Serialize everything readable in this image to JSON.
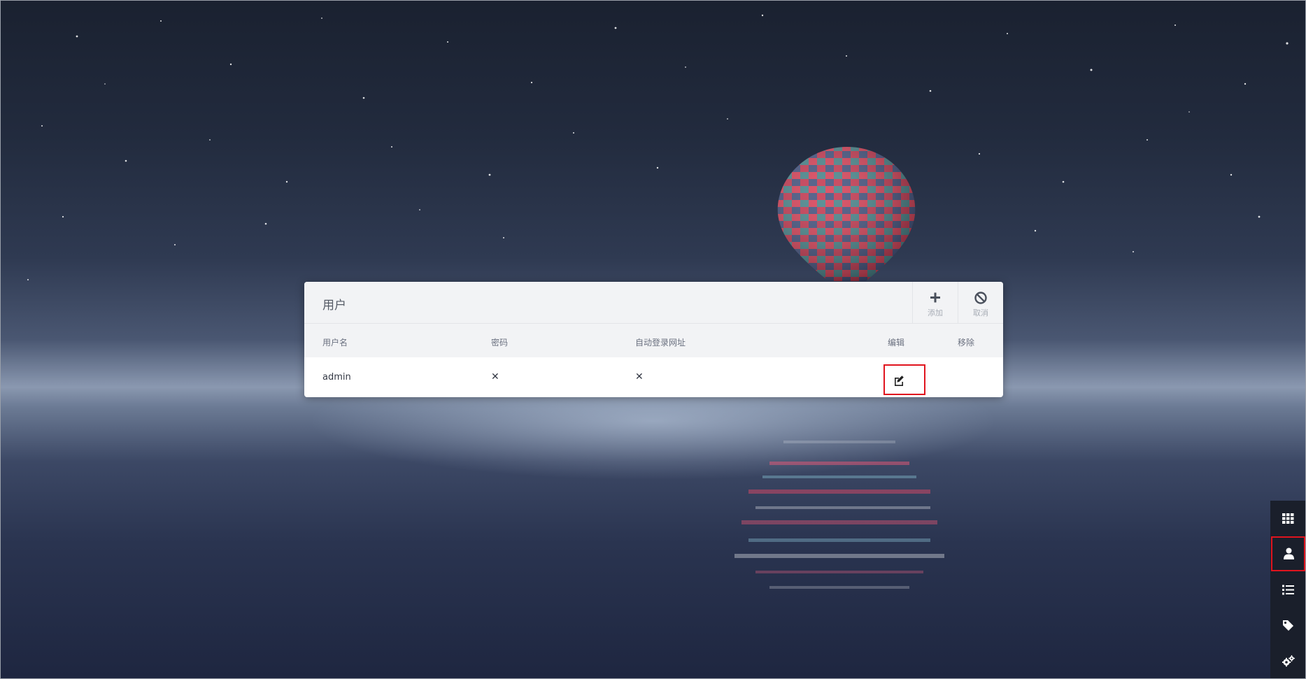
{
  "panel": {
    "title": "用户",
    "actions": [
      {
        "label": "添加",
        "icon": "plus-icon"
      },
      {
        "label": "取消",
        "icon": "ban-icon"
      }
    ]
  },
  "table": {
    "columns": [
      "用户名",
      "密码",
      "自动登录网址",
      "编辑",
      "移除"
    ],
    "rows": [
      {
        "username": "admin",
        "password": "✕",
        "auto_login_url": "✕",
        "edit_icon": "edit-icon"
      }
    ]
  },
  "sidebar": {
    "items": [
      {
        "icon": "grid-icon"
      },
      {
        "icon": "user-icon",
        "active": true
      },
      {
        "icon": "list-icon"
      },
      {
        "icon": "tag-icon"
      },
      {
        "icon": "gears-icon"
      }
    ]
  },
  "colors": {
    "highlight": "#e0141e",
    "panel_bg": "#ffffff",
    "header_bg": "#f2f3f5",
    "sidebar_bg": "#1a1f2b"
  }
}
